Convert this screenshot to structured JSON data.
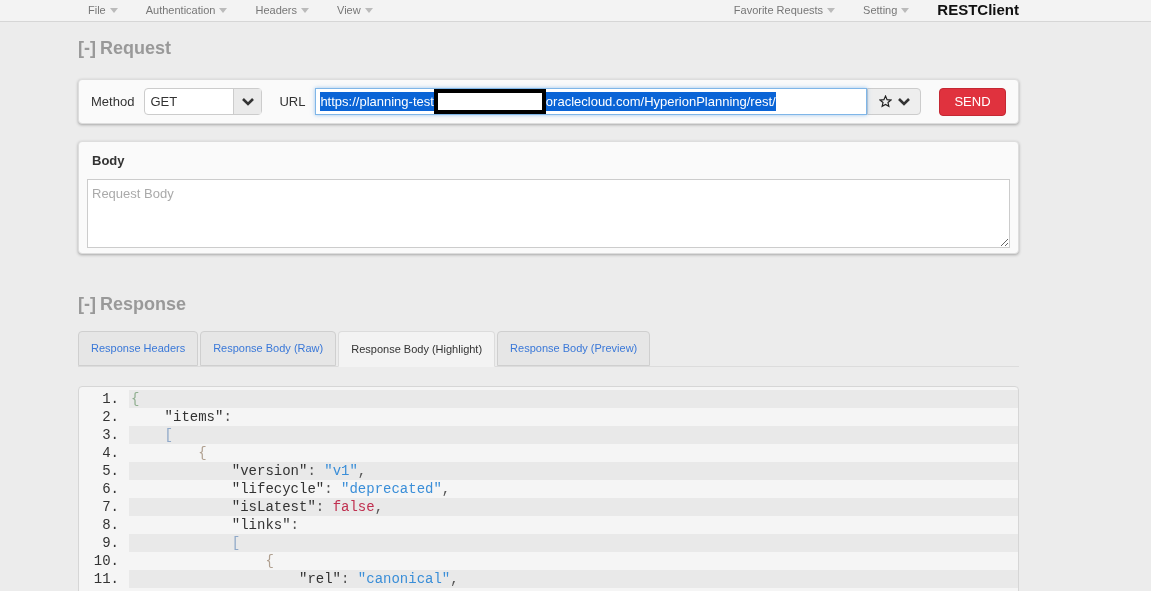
{
  "menu": {
    "left": [
      {
        "label": "File"
      },
      {
        "label": "Authentication"
      },
      {
        "label": "Headers"
      },
      {
        "label": "View"
      }
    ],
    "right": [
      {
        "label": "Favorite Requests"
      },
      {
        "label": "Setting"
      }
    ],
    "brand": "RESTClient"
  },
  "request": {
    "toggle": "[-]",
    "title": "Request",
    "method_label": "Method",
    "method": "GET",
    "url_label": "URL",
    "url_start": "https://planning-test",
    "url_end": "oraclecloud.com/HyperionPlanning/rest/",
    "url_selected": true,
    "send": "SEND"
  },
  "body": {
    "title": "Body",
    "placeholder": "Request Body"
  },
  "response": {
    "toggle": "[-]",
    "title": "Response",
    "tabs": [
      {
        "label": "Response Headers",
        "selected": false
      },
      {
        "label": "Response Body (Raw)",
        "selected": false
      },
      {
        "label": "Response Body (Highlight)",
        "selected": true
      },
      {
        "label": "Response Body (Preview)",
        "selected": false
      }
    ],
    "lines": [
      {
        "number": "1.",
        "tokens": [
          {
            "kind": "brace",
            "text": "{"
          }
        ]
      },
      {
        "number": "2.",
        "tokens": [
          {
            "kind": "key",
            "text": "\"items\""
          },
          {
            "kind": "punct",
            "text": ":"
          }
        ]
      },
      {
        "number": "3.",
        "tokens": [
          {
            "kind": "bracket",
            "text": "["
          }
        ]
      },
      {
        "number": "4.",
        "tokens": [
          {
            "kind": "brace2",
            "text": "{"
          }
        ]
      },
      {
        "number": "5.",
        "tokens": [
          {
            "kind": "key",
            "text": "\"version\""
          },
          {
            "kind": "punct",
            "text": ": "
          },
          {
            "kind": "string",
            "text": "\"v1\""
          },
          {
            "kind": "punct",
            "text": ","
          }
        ]
      },
      {
        "number": "6.",
        "tokens": [
          {
            "kind": "key",
            "text": "\"lifecycle\""
          },
          {
            "kind": "punct",
            "text": ": "
          },
          {
            "kind": "string",
            "text": "\"deprecated\""
          },
          {
            "kind": "punct",
            "text": ","
          }
        ]
      },
      {
        "number": "7.",
        "tokens": [
          {
            "kind": "key",
            "text": "\"isLatest\""
          },
          {
            "kind": "punct",
            "text": ": "
          },
          {
            "kind": "bool",
            "text": "false"
          },
          {
            "kind": "punct",
            "text": ","
          }
        ]
      },
      {
        "number": "8.",
        "tokens": [
          {
            "kind": "key",
            "text": "\"links\""
          },
          {
            "kind": "punct",
            "text": ":"
          }
        ]
      },
      {
        "number": "9.",
        "tokens": [
          {
            "kind": "bracket",
            "text": "["
          }
        ]
      },
      {
        "number": "10.",
        "tokens": [
          {
            "kind": "brace2",
            "text": "{"
          }
        ]
      },
      {
        "number": "11.",
        "tokens": [
          {
            "kind": "key",
            "text": "\"rel\""
          },
          {
            "kind": "punct",
            "text": ": "
          },
          {
            "kind": "string",
            "text": "\"canonical\""
          },
          {
            "kind": "punct",
            "text": ","
          }
        ]
      }
    ]
  }
}
